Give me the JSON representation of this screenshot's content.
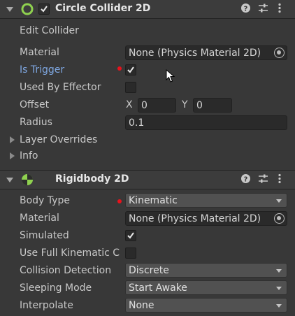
{
  "circle_collider": {
    "title": "Circle Collider 2D",
    "edit_collider": "Edit Collider",
    "material": {
      "label": "Material",
      "value": "None (Physics Material 2D)"
    },
    "is_trigger": {
      "label": "Is Trigger",
      "checked": true
    },
    "used_by_effector": {
      "label": "Used By Effector",
      "checked": false
    },
    "offset": {
      "label": "Offset",
      "x_label": "X",
      "x": "0",
      "y_label": "Y",
      "y": "0"
    },
    "radius": {
      "label": "Radius",
      "value": "0.1"
    },
    "layer_overrides": "Layer Overrides",
    "info": "Info"
  },
  "rigidbody": {
    "title": "Rigidbody 2D",
    "body_type": {
      "label": "Body Type",
      "value": "Kinematic"
    },
    "material": {
      "label": "Material",
      "value": "None (Physics Material 2D)"
    },
    "simulated": {
      "label": "Simulated",
      "checked": true
    },
    "use_full_kinematic": {
      "label": "Use Full Kinematic C",
      "checked": false
    },
    "collision_detection": {
      "label": "Collision Detection",
      "value": "Discrete"
    },
    "sleeping_mode": {
      "label": "Sleeping Mode",
      "value": "Start Awake"
    },
    "interpolate": {
      "label": "Interpolate",
      "value": "None"
    }
  },
  "colors": {
    "background": "#383838",
    "highlight_label": "#7ea6e0",
    "override_dot": "#e8121c",
    "collider_icon": "#8fd14f"
  },
  "icons": [
    "foldout-icon",
    "circle-collider-icon",
    "rigidbody-icon",
    "help-icon",
    "presets-icon",
    "menu-icon",
    "object-picker-icon",
    "cursor-icon"
  ]
}
